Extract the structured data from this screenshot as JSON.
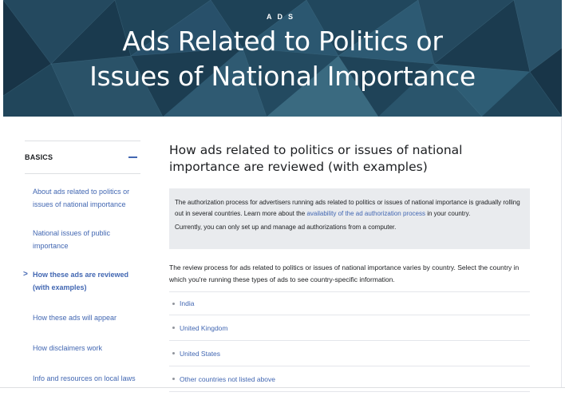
{
  "hero": {
    "eyebrow": "ADS",
    "title_line1": "Ads Related to Politics or",
    "title_line2": "Issues of National Importance"
  },
  "sidebar": {
    "title": "BASICS",
    "collapse_icon": "minus-icon",
    "items": [
      {
        "label": "About ads related to politics or issues of national importance",
        "active": false
      },
      {
        "label": "National issues of public importance",
        "active": false
      },
      {
        "label": "How these ads are reviewed (with examples)",
        "active": true
      },
      {
        "label": "How these ads will appear",
        "active": false
      },
      {
        "label": "How disclaimers work",
        "active": false
      },
      {
        "label": "Info and resources on local laws",
        "active": false
      }
    ],
    "active_marker": ">"
  },
  "main": {
    "title": "How ads related to politics or issues of national importance are reviewed (with examples)",
    "notice": {
      "text_before_link": "The authorization process for advertisers running ads related to politics or issues of national importance is gradually rolling out in several countries. Learn more about the ",
      "link": "availability of the ad authorization process",
      "text_after_link": " in your country.",
      "second": "Currently, you can only set up and manage ad authorizations from a computer."
    },
    "intro": "The review process for ads related to politics or issues of national importance varies by country. Select the country in which you're running these types of ads to see country-specific information.",
    "countries": [
      "India",
      "United Kingdom",
      "United States",
      "Other countries not listed above"
    ]
  },
  "colors": {
    "hero_bg": "#1b3a4f",
    "link": "#4267b2",
    "notice_bg": "#e9ebee"
  }
}
